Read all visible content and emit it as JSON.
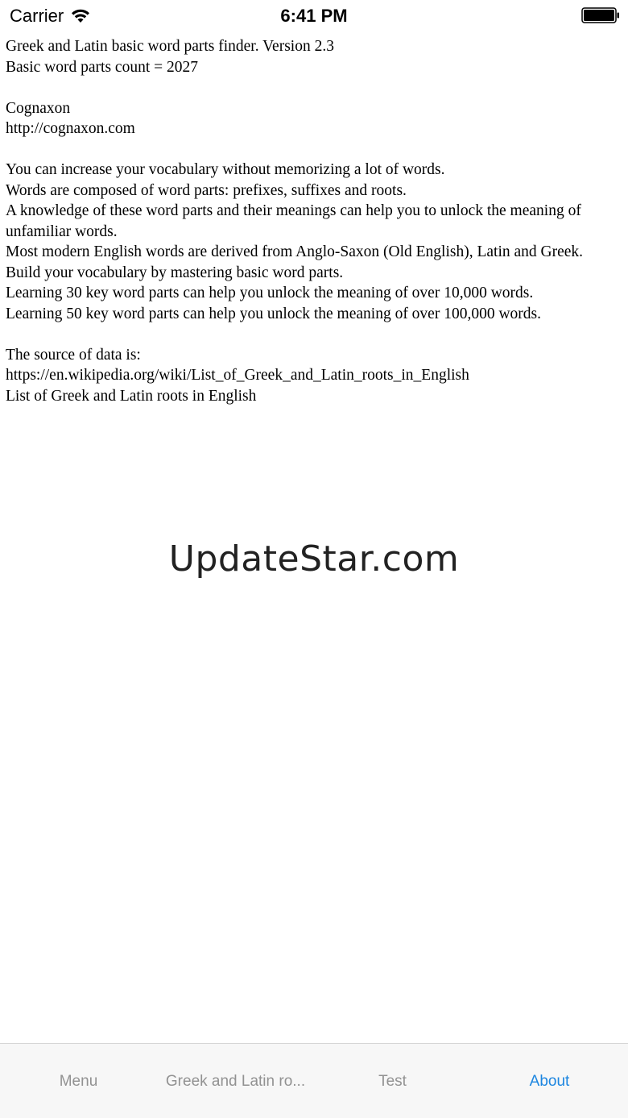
{
  "status_bar": {
    "carrier": "Carrier",
    "time": "6:41 PM"
  },
  "content": {
    "lines": [
      "Greek and Latin basic word parts finder. Version 2.3",
      "Basic word parts count = 2027",
      "",
      "Cognaxon",
      "http://cognaxon.com",
      "",
      "You can increase your vocabulary without memorizing a lot of words.",
      "Words are composed of word parts: prefixes, suffixes and roots.",
      "A knowledge of these word parts and their meanings can help you to unlock the meaning of unfamiliar words.",
      "Most modern English words are derived from Anglo-Saxon (Old English), Latin and Greek.",
      "Build your vocabulary by mastering basic word parts.",
      "Learning 30 key word parts can help you unlock the meaning of over 10,000 words.",
      "Learning 50 key word parts can help you unlock the meaning of over 100,000 words.",
      "",
      "The source of data is:",
      "https://en.wikipedia.org/wiki/List_of_Greek_and_Latin_roots_in_English",
      "List of Greek and Latin roots in English"
    ]
  },
  "watermark": "UpdateStar.com",
  "tab_bar": {
    "tabs": [
      {
        "label": "Menu",
        "active": false
      },
      {
        "label": "Greek and Latin ro...",
        "active": false
      },
      {
        "label": "Test",
        "active": false
      },
      {
        "label": "About",
        "active": true
      }
    ],
    "active_color": "#1d86e0",
    "inactive_color": "#929292"
  }
}
